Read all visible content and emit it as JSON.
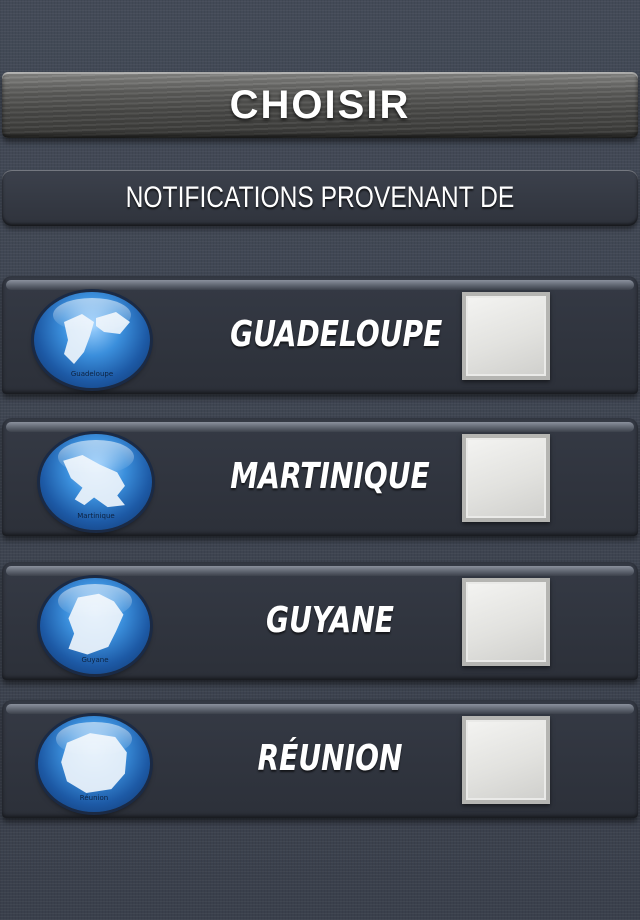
{
  "header": {
    "title": "CHOISIR"
  },
  "subheader": {
    "title": "NOTIFICATIONS PROVENANT DE"
  },
  "regions": [
    {
      "label": "GUADELOUPE",
      "globe_caption": "Guadeloupe",
      "icon": "guadeloupe-map-globe-icon",
      "checked": false
    },
    {
      "label": "MARTINIQUE",
      "globe_caption": "Martinique",
      "icon": "martinique-map-globe-icon",
      "checked": false
    },
    {
      "label": "GUYANE",
      "globe_caption": "Guyane",
      "icon": "guyane-map-globe-icon",
      "checked": false
    },
    {
      "label": "RÉUNION",
      "globe_caption": "Réunion",
      "icon": "reunion-map-globe-icon",
      "checked": false
    }
  ],
  "colors": {
    "background": "#3d434f",
    "globe": "#3b8fdc",
    "checkbox": "#e8e8e6",
    "text": "#ffffff"
  }
}
